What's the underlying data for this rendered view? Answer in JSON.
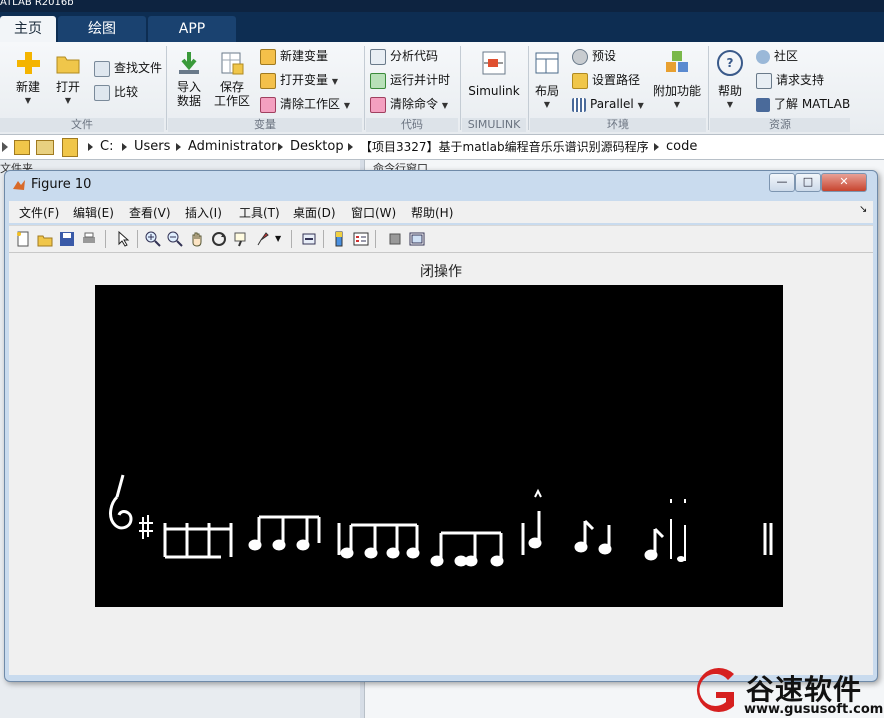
{
  "app": {
    "title": "ATLAB R2016b"
  },
  "tabs": [
    {
      "label": "主页"
    },
    {
      "label": "绘图"
    },
    {
      "label": "APP"
    }
  ],
  "ribbon": {
    "file": {
      "new": "新建",
      "open": "打开",
      "find_files": "查找文件",
      "compare": "比较",
      "group": "文件"
    },
    "variable": {
      "import": "导入\n数据",
      "import_l1": "导入",
      "import_l2": "数据",
      "save_l1": "保存",
      "save_l2": "工作区",
      "new_variable": "新建变量",
      "open_variable": "打开变量",
      "clear_workspace": "清除工作区",
      "group": "变量"
    },
    "code": {
      "analyze": "分析代码",
      "run_time": "运行并计时",
      "clear_commands": "清除命令",
      "group": "代码"
    },
    "simulink": {
      "label": "Simulink",
      "group": "SIMULINK"
    },
    "environment": {
      "layout": "布局",
      "preferences": "预设",
      "set_path": "设置路径",
      "parallel": "Parallel",
      "addons": "附加功能",
      "group": "环境"
    },
    "resources": {
      "help": "帮助",
      "community": "社区",
      "request_support": "请求支持",
      "learn_matlab": "了解 MATLAB",
      "group": "资源"
    }
  },
  "address": {
    "crumbs": [
      "C:",
      "Users",
      "Administrator",
      "Desktop",
      "【项目3327】基于matlab编程音乐乐谱识别源码程序",
      "code"
    ]
  },
  "panels": {
    "file_panel": "文件夹",
    "command_window": "命令行窗口"
  },
  "figure": {
    "title": "Figure 10",
    "menu": [
      "文件(F)",
      "编辑(E)",
      "查看(V)",
      "插入(I)",
      "工具(T)",
      "桌面(D)",
      "窗口(W)",
      "帮助(H)"
    ],
    "plot_title": "闭操作",
    "window_buttons": {
      "minimize": "—",
      "maximize": "□",
      "close": "✕"
    }
  },
  "watermark": {
    "brand": "谷速软件",
    "url": "www.gususoft.com"
  },
  "colors": {
    "tabbar": "#0d2d52",
    "axes_bg": "#000000",
    "glyph": "#ffffff",
    "accent": "#d62020"
  }
}
